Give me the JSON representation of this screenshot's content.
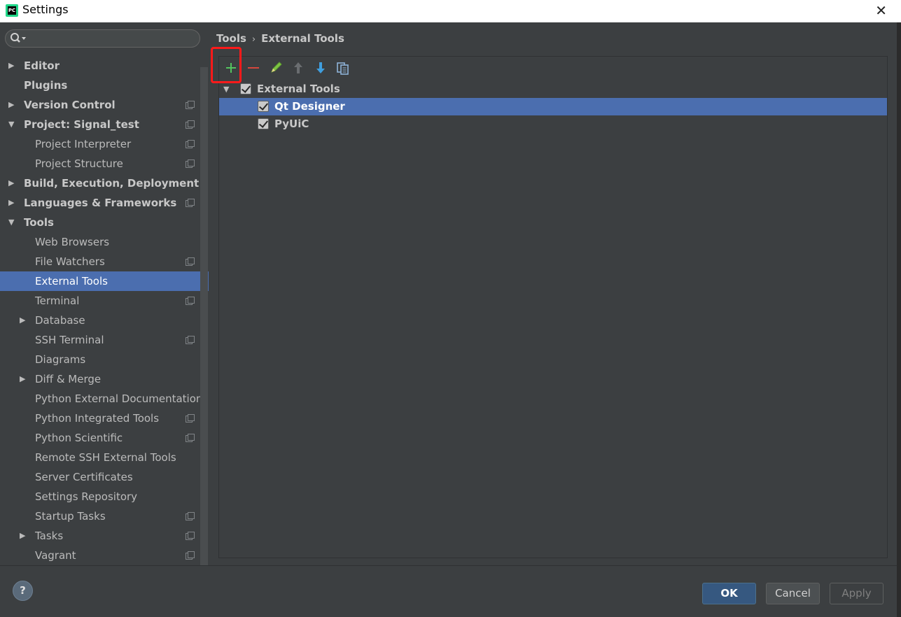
{
  "window": {
    "title": "Settings",
    "app_icon_text": "PC",
    "close_glyph": "✕"
  },
  "search": {
    "placeholder": "",
    "icon": "search-icon"
  },
  "sidebar": {
    "items": [
      {
        "label": "Editor",
        "bold": true,
        "arrow": "▶",
        "indent": 0,
        "proj": false
      },
      {
        "label": "Plugins",
        "bold": true,
        "arrow": "",
        "indent": 0,
        "proj": false
      },
      {
        "label": "Version Control",
        "bold": true,
        "arrow": "▶",
        "indent": 0,
        "proj": true
      },
      {
        "label": "Project: Signal_test",
        "bold": true,
        "arrow": "▼",
        "indent": 0,
        "proj": true
      },
      {
        "label": "Project Interpreter",
        "bold": false,
        "arrow": "",
        "indent": 1,
        "proj": true
      },
      {
        "label": "Project Structure",
        "bold": false,
        "arrow": "",
        "indent": 1,
        "proj": true
      },
      {
        "label": "Build, Execution, Deployment",
        "bold": true,
        "arrow": "▶",
        "indent": 0,
        "proj": false
      },
      {
        "label": "Languages & Frameworks",
        "bold": true,
        "arrow": "▶",
        "indent": 0,
        "proj": true
      },
      {
        "label": "Tools",
        "bold": true,
        "arrow": "▼",
        "indent": 0,
        "proj": false
      },
      {
        "label": "Web Browsers",
        "bold": false,
        "arrow": "",
        "indent": 1,
        "proj": false
      },
      {
        "label": "File Watchers",
        "bold": false,
        "arrow": "",
        "indent": 1,
        "proj": true
      },
      {
        "label": "External Tools",
        "bold": false,
        "arrow": "",
        "indent": 1,
        "proj": false,
        "selected": true
      },
      {
        "label": "Terminal",
        "bold": false,
        "arrow": "",
        "indent": 1,
        "proj": true
      },
      {
        "label": "Database",
        "bold": false,
        "arrow": "▶",
        "indent": 1,
        "proj": false
      },
      {
        "label": "SSH Terminal",
        "bold": false,
        "arrow": "",
        "indent": 1,
        "proj": true
      },
      {
        "label": "Diagrams",
        "bold": false,
        "arrow": "",
        "indent": 1,
        "proj": false
      },
      {
        "label": "Diff & Merge",
        "bold": false,
        "arrow": "▶",
        "indent": 1,
        "proj": false
      },
      {
        "label": "Python External Documentation",
        "bold": false,
        "arrow": "",
        "indent": 1,
        "proj": false
      },
      {
        "label": "Python Integrated Tools",
        "bold": false,
        "arrow": "",
        "indent": 1,
        "proj": true
      },
      {
        "label": "Python Scientific",
        "bold": false,
        "arrow": "",
        "indent": 1,
        "proj": true
      },
      {
        "label": "Remote SSH External Tools",
        "bold": false,
        "arrow": "",
        "indent": 1,
        "proj": false
      },
      {
        "label": "Server Certificates",
        "bold": false,
        "arrow": "",
        "indent": 1,
        "proj": false
      },
      {
        "label": "Settings Repository",
        "bold": false,
        "arrow": "",
        "indent": 1,
        "proj": false
      },
      {
        "label": "Startup Tasks",
        "bold": false,
        "arrow": "",
        "indent": 1,
        "proj": true
      },
      {
        "label": "Tasks",
        "bold": false,
        "arrow": "▶",
        "indent": 1,
        "proj": true
      },
      {
        "label": "Vagrant",
        "bold": false,
        "arrow": "",
        "indent": 1,
        "proj": true
      }
    ]
  },
  "breadcrumb": {
    "parent": "Tools",
    "separator": "›",
    "current": "External Tools"
  },
  "toolbar": {
    "buttons": [
      {
        "name": "add-icon",
        "glyph": "+"
      },
      {
        "name": "remove-icon",
        "glyph": "−"
      },
      {
        "name": "edit-icon",
        "glyph": "pencil"
      },
      {
        "name": "move-up-icon",
        "glyph": "↑"
      },
      {
        "name": "move-down-icon",
        "glyph": "↓"
      },
      {
        "name": "copy-icon",
        "glyph": "copy"
      }
    ],
    "highlight_color": "#ff1a1a"
  },
  "tools_tree": {
    "group": {
      "label": "External Tools",
      "checked": true,
      "expanded": true
    },
    "children": [
      {
        "label": "Qt Designer",
        "checked": true,
        "selected": true
      },
      {
        "label": "PyUiC",
        "checked": true,
        "selected": false
      }
    ]
  },
  "footer": {
    "help": "?",
    "ok": "OK",
    "cancel": "Cancel",
    "apply": "Apply"
  },
  "colors": {
    "background": "#3c3f41",
    "selection": "#4b6eaf",
    "ok_button": "#365880"
  }
}
